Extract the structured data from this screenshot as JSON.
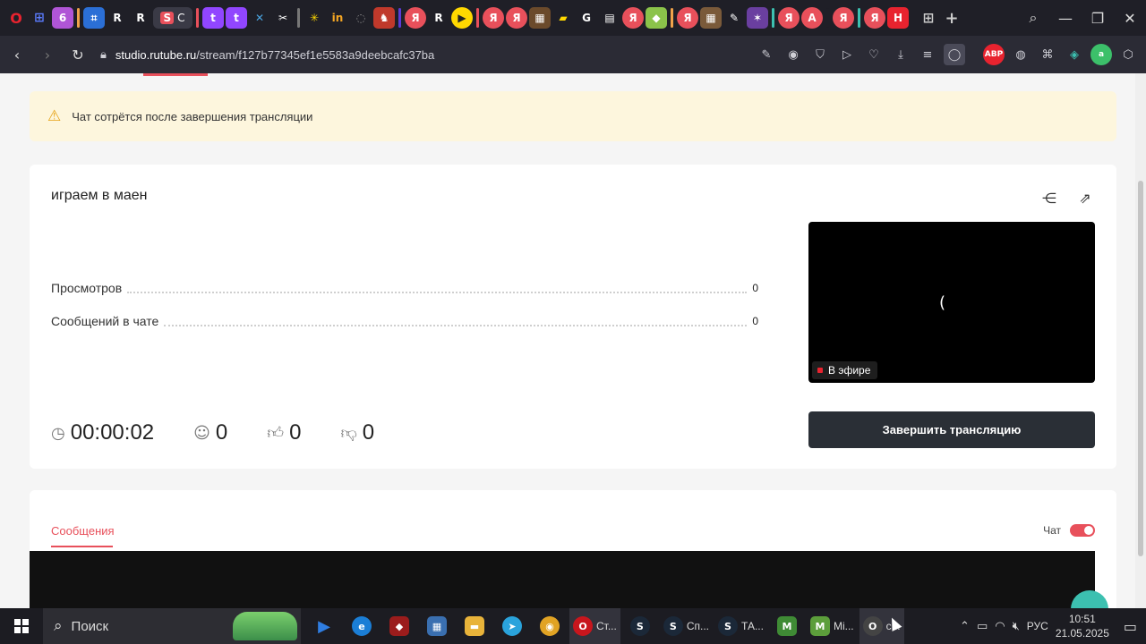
{
  "browser": {
    "url_host": "studio.rutube.ru",
    "url_path": "/stream/f127b77345ef1e5583a9deebcafc37ba",
    "active_tab_label": "С"
  },
  "banner": {
    "text": "Чат сотрётся после завершения трансляции"
  },
  "stream": {
    "title": "играем в маен",
    "stats": [
      {
        "label": "Просмотров",
        "value": "0"
      },
      {
        "label": "Сообщений в чате",
        "value": "0"
      }
    ],
    "duration": "00:00:02",
    "viewers": "0",
    "likes": "0",
    "dislikes": "0",
    "spinner_glyph": "(",
    "live_label": "В эфире",
    "end_button": "Завершить трансляцию"
  },
  "messages": {
    "tab_label": "Сообщения",
    "chat_label": "Чат"
  },
  "taskbar": {
    "search_placeholder": "Поиск",
    "apps": [
      {
        "label": "Ст...",
        "color": "#c8161d",
        "glyph": "O"
      },
      {
        "label": "",
        "color": "#1b2838",
        "glyph": "S"
      },
      {
        "label": "Сп...",
        "color": "#1b2838",
        "glyph": "S"
      },
      {
        "label": "ТА...",
        "color": "#1b2838",
        "glyph": "S"
      },
      {
        "label": "",
        "color": "#3f8b35",
        "glyph": "M"
      },
      {
        "label": "Mi...",
        "color": "#5c9e3b",
        "glyph": "M"
      },
      {
        "label": "с...",
        "color": "#444",
        "glyph": "O"
      }
    ],
    "lang": "РУС",
    "time": "10:51",
    "date": "21.05.2025"
  }
}
